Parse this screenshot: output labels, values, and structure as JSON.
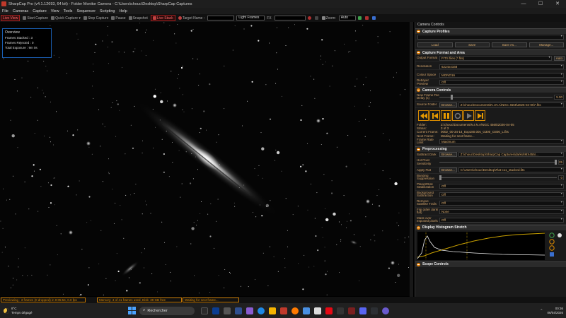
{
  "window": {
    "title": "SharpCap Pro (v4.1.12693, 64 bit) - Folder Monitor Camera - C:\\Users\\chouc\\Desktop\\SharpCap Captures",
    "controls": [
      "—",
      "☐",
      "✕"
    ]
  },
  "menu": [
    "File",
    "Cameras",
    "Capture",
    "View",
    "Tools",
    "Sequencer",
    "Scripting",
    "Help"
  ],
  "toolbar": {
    "live_view": "Live View",
    "start_capture": "Start Capture",
    "quick_capture": "Quick Capture",
    "stop_capture": "Stop Capture",
    "pause": "Pause",
    "snapshot": "Snapshot",
    "live_stack": "Live Stack",
    "target_name_label": "Target Name :",
    "target_name_value": "",
    "frame_type": "Light Frames",
    "fx_label": "FX",
    "fx_value": "",
    "zoom_label": "Zoom:",
    "zoom_value": "Auto"
  },
  "overview": {
    "title": "Overview",
    "frames_stacked": "Frames Stacked : 3",
    "frames_rejected": "Frames Rejected : 0",
    "total_exposure": "Total Exposure : 9m 0s"
  },
  "status": {
    "previewing": "Previewing : 3 frames (0 dropped) in 0:05:54, 0.0 fps",
    "memory": "Memory: 4 of 41 frames used, Disk: 39 GB free",
    "waiting": "Waiting for next frame..."
  },
  "panel": {
    "title": "Camera Controls",
    "capture_profiles": {
      "header": "Capture Profiles",
      "profile_value": "",
      "load": "Load",
      "save": "Save",
      "save_as": "Save As...",
      "manage": "Manage..."
    },
    "capture_format": {
      "header": "Capture Format and Area",
      "output_format_label": "Output Format",
      "output_format_value": "FITS files (*.fits)",
      "auto_label": "Auto",
      "resolution_label": "Resolution",
      "resolution_value": "6224x4168",
      "colour_space_label": "Colour Space",
      "colour_space_value": "MONO16",
      "debayer_label": "Debayer Preview",
      "debayer_value": "Off"
    },
    "camera_controls": {
      "header": "Camera Controls",
      "new_frame_delay_label": "New Frame File Delay (s)",
      "new_frame_delay_value": "5.00",
      "source_folder_label": "Source Folder",
      "browse": "Browse...",
      "source_folder_value": "Z:\\chouc\\Documents\\N.I.N.A\\NGC 4565\\2026-04-05\\*.fits",
      "folder_label": "Folder:",
      "folder_value": "Z:\\chouc\\Documents\\N.I.N.A\\NGC 4565\\2026-04-05",
      "status_label": "Status:",
      "status_value": "3 of 3",
      "current_frame_label": "Current Frame:",
      "current_frame_value": "0002_00-34-14_Exp180.00s_G300_O300_L.fits",
      "next_frame_label": "Next Frame:",
      "next_frame_value": "Waiting for next frame...",
      "frame_rate_label": "Frame Rate Limit",
      "frame_rate_value": "Maximum"
    },
    "preprocessing": {
      "header": "Preprocessing",
      "subtract_dark_label": "Subtract Dark",
      "subtract_dark_browse": "Browse...",
      "subtract_dark_value": "Z:\\chouc\\Desktop\\SharpCap Captures\\darks\\IMX455\\...",
      "hot_pixel_label": "Hot Pixel Sensitivity",
      "hot_pixel_value": "25",
      "apply_flat_label": "Apply Flat",
      "apply_flat_browse": "Browse...",
      "apply_flat_value": "C:\\Users\\chouc\\Desktop\\Flat-c11_stacked.fits",
      "banding_label": "Banding Suppression",
      "banding_value": "0",
      "planet_disk_label": "Planet/Disk Stabilization",
      "planet_disk_value": "Off",
      "background_sub_label": "Background Subtraction",
      "background_sub_value": "Off",
      "satellite_label": "Remove Satellite Trails",
      "satellite_value": "Off",
      "flip_label": "Flip (after dark/ flat)",
      "flip_value": "None",
      "mask_label": "Mask over exposed pixels",
      "mask_value": "Off"
    },
    "histogram": {
      "header": "Display Histogram Stretch"
    },
    "scope_controls": {
      "header": "Scope Controls"
    }
  },
  "taskbar": {
    "temperature": "8°C",
    "weather": "Temps dégagé",
    "search_placeholder": "Rechercher",
    "time": "00:36",
    "date": "06/04/2026"
  }
}
